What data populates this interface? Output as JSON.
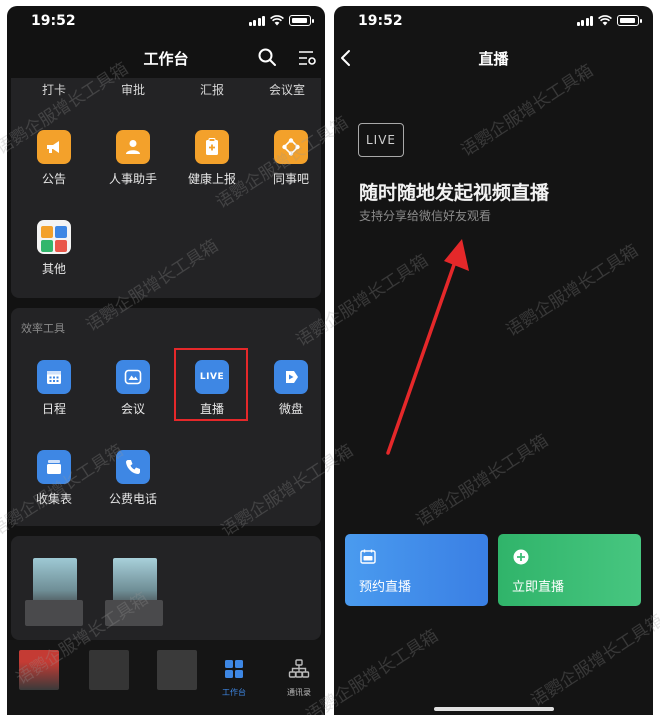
{
  "left_screen": {
    "status": {
      "time": "19:52"
    },
    "nav": {
      "title": "工作台"
    },
    "top_labels": [
      "打卡",
      "审批",
      "汇报",
      "会议室"
    ],
    "row1": [
      {
        "label": "公告",
        "icon": "megaphone-icon",
        "color": "#f3a12b"
      },
      {
        "label": "人事助手",
        "icon": "person-icon",
        "color": "#f3a12b"
      },
      {
        "label": "健康上报",
        "icon": "clipboard-icon",
        "color": "#f3a12b"
      },
      {
        "label": "同事吧",
        "icon": "share-icon",
        "color": "#f3a12b"
      }
    ],
    "row2": [
      {
        "label": "其他",
        "icon": "grid-apps-icon"
      }
    ],
    "efficiency": {
      "title": "效率工具",
      "row1": [
        {
          "label": "日程",
          "icon": "calendar-icon",
          "color": "#3e87e4"
        },
        {
          "label": "会议",
          "icon": "meeting-icon",
          "color": "#3e87e4"
        },
        {
          "label": "直播",
          "icon": "live-icon",
          "badge": "LIVE",
          "color": "#3e87e4"
        },
        {
          "label": "微盘",
          "icon": "drive-icon",
          "color": "#3e87e4"
        }
      ],
      "row2": [
        {
          "label": "收集表",
          "icon": "form-icon",
          "color": "#3e87e4"
        },
        {
          "label": "公费电话",
          "icon": "phone-icon",
          "color": "#3e87e4"
        }
      ]
    },
    "tabs": [
      {
        "label": "工作台",
        "icon": "workbench-icon",
        "active": true
      },
      {
        "label": "通讯录",
        "icon": "contacts-icon",
        "active": false
      }
    ]
  },
  "right_screen": {
    "status": {
      "time": "19:52"
    },
    "nav": {
      "title": "直播"
    },
    "live_badge": "LIVE",
    "heading": "随时随地发起视频直播",
    "subheading": "支持分享给微信好友观看",
    "actions": [
      {
        "label": "预约直播",
        "icon": "schedule-live-icon",
        "color": "#3a7fe4"
      },
      {
        "label": "立即直播",
        "icon": "plus-circle-icon",
        "color": "#30b46a"
      }
    ]
  },
  "watermark": "语鹦企服增长工具箱",
  "colors": {
    "accent_orange": "#f3a12b",
    "accent_blue": "#3e87e4",
    "accent_green": "#30b46a",
    "highlight_red": "#e5282a",
    "arrow_red": "#e5282a"
  }
}
